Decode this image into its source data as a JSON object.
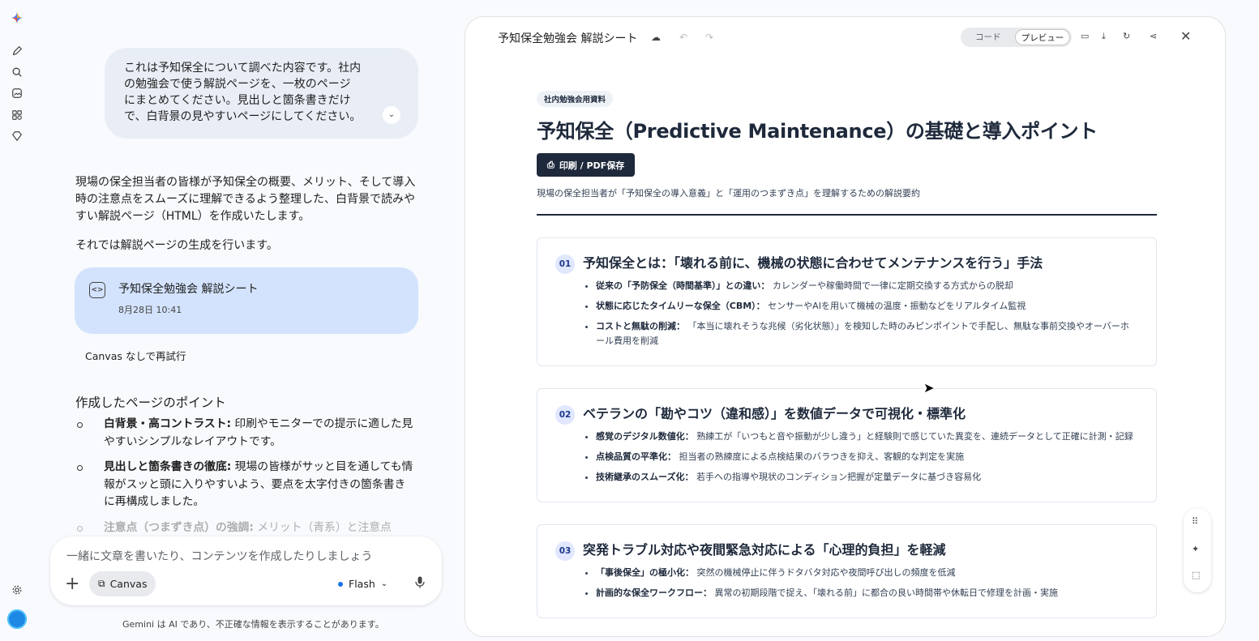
{
  "rail": {
    "icons": [
      "gemini-logo",
      "new-chat-icon",
      "search-icon",
      "gallery-icon",
      "apps-icon",
      "gems-icon"
    ],
    "settings_icon": "gear-icon",
    "avatar_color": "#1e88e5"
  },
  "chat": {
    "user_message": "これは予知保全について調べた内容です。社内の勉強会で使う解説ページを、一枚のページにまとめてください。見出しと箇条書きだけで、白背景の見やすいページにしてください。",
    "response_intro": "現場の保全担当者の皆様が予知保全の概要、メリット、そして導入時の注意点をスムーズに理解できるよう整理した、白背景で読みやすい解説ページ（HTML）を作成いたします。",
    "response_gen": "それでは解説ページの生成を行います。",
    "canvas_card": {
      "title": "予知保全勉強会 解説シート",
      "date": "8月28日 10:41"
    },
    "retry_label": "Canvas なしで再試行",
    "points_heading": "作成したページのポイント",
    "points": [
      {
        "bold": "白背景・高コントラスト:",
        "text": " 印刷やモニターでの提示に適した見やすいシンプルなレイアウトです。"
      },
      {
        "bold": "見出しと箇条書きの徹底:",
        "text": " 現場の皆様がサッと目を通しても情報がスッと頭に入りやすいよう、要点を太字付きの箇条書きに再構成しました。"
      },
      {
        "bold": "注意点（つまずき点）の強調:",
        "text": " メリット（青系）と注意点"
      }
    ]
  },
  "input": {
    "placeholder": "一緒に文章を書いたり、コンテンツを作成したりしましょう",
    "canvas_label": "Canvas",
    "model_label": "Flash",
    "disclaimer": "Gemini は AI であり、不正確な情報を表示することがあります。"
  },
  "panel": {
    "title": "予知保全勉強会 解説シート",
    "toggle_code": "コード",
    "toggle_preview": "プレビュー",
    "doc": {
      "badge": "社内勉強会用資料",
      "title": "予知保全（Predictive Maintenance）の基礎と導入ポイント",
      "print_label": "印刷 / PDF保存",
      "subtitle": "現場の保全担当者が「予知保全の導入意義」と「運用のつまずき点」を理解するための解説要約",
      "sections": [
        {
          "num": "01",
          "heading": "予知保全とは：「壊れる前に、機械の状態に合わせてメンテナンスを行う」手法",
          "items": [
            {
              "bold": "従来の「予防保全（時間基準）」との違い：",
              "text": " カレンダーや稼働時間で一律に定期交換する方式からの脱却"
            },
            {
              "bold": "状態に応じたタイムリーな保全（CBM）：",
              "text": " センサーやAIを用いて機械の温度・振動などをリアルタイム監視"
            },
            {
              "bold": "コストと無駄の削減：",
              "text": " 「本当に壊れそうな兆候（劣化状態）」を検知した時のみピンポイントで手配し、無駄な事前交換やオーバーホール費用を削減"
            }
          ]
        },
        {
          "num": "02",
          "heading": "ベテランの「勘やコツ（違和感）」を数値データで可視化・標準化",
          "items": [
            {
              "bold": "感覚のデジタル数値化：",
              "text": " 熟練工が「いつもと音や振動が少し違う」と経験則で感じていた異変を、連続データとして正確に計測・記録"
            },
            {
              "bold": "点検品質の平準化：",
              "text": " 担当者の熟練度による点検結果のバラつきを抑え、客観的な判定を実施"
            },
            {
              "bold": "技術継承のスムーズ化：",
              "text": " 若手への指導や現状のコンディション把握が定量データに基づき容易化"
            }
          ]
        },
        {
          "num": "03",
          "heading": "突発トラブル対応や夜間緊急対応による「心理的負担」を軽減",
          "items": [
            {
              "bold": "「事後保全」の極小化：",
              "text": " 突然の機械停止に伴うドタバタ対応や夜間呼び出しの頻度を低減"
            },
            {
              "bold": "計画的な保全ワークフロー：",
              "text": " 異常の初期段階で捉え、「壊れる前」に都合の良い時間帯や休転日で修理を計画・実施"
            }
          ]
        }
      ]
    }
  }
}
